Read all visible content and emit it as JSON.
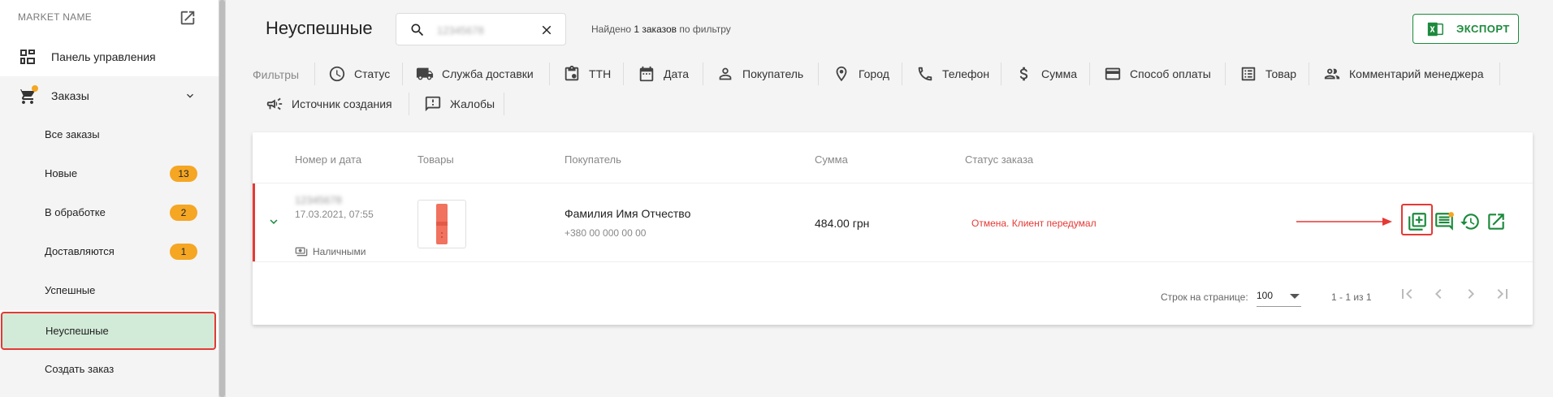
{
  "sidebar": {
    "market_name": "MARKET NAME",
    "dashboard_label": "Панель управления",
    "orders_label": "Заказы",
    "items": [
      {
        "label": "Все заказы",
        "badge": ""
      },
      {
        "label": "Новые",
        "badge": "13"
      },
      {
        "label": "В обработке",
        "badge": "2"
      },
      {
        "label": "Доставляются",
        "badge": "1"
      },
      {
        "label": "Успешные",
        "badge": ""
      },
      {
        "label": "Неуспешные",
        "badge": "",
        "active": true
      },
      {
        "label": "Создать заказ",
        "badge": ""
      }
    ],
    "badge_color": "#f5a623",
    "active_color": "#d2ebd8"
  },
  "header": {
    "title": "Неуспешные",
    "search_value": "12345678",
    "found_prefix": "Найдено ",
    "found_count": "1",
    "found_suffix": " заказов",
    "found_tail": " по фильтру",
    "export_label": "ЭКСПОРТ"
  },
  "filters": {
    "label": "Фильтры",
    "items": [
      {
        "label": "Статус",
        "icon": "clock-icon"
      },
      {
        "label": "Служба доставки",
        "icon": "truck-icon"
      },
      {
        "label": "ТТН",
        "icon": "clipboard-icon"
      },
      {
        "label": "Дата",
        "icon": "calendar-icon"
      },
      {
        "label": "Покупатель",
        "icon": "person-icon"
      },
      {
        "label": "Город",
        "icon": "location-icon"
      },
      {
        "label": "Телефон",
        "icon": "phone-icon"
      },
      {
        "label": "Сумма",
        "icon": "dollar-icon"
      },
      {
        "label": "Способ оплаты",
        "icon": "card-icon"
      },
      {
        "label": "Товар",
        "icon": "list-icon"
      },
      {
        "label": "Комментарий менеджера",
        "icon": "people-icon"
      },
      {
        "label": "Источник создания",
        "icon": "megaphone-icon"
      },
      {
        "label": "Жалобы",
        "icon": "feedback-icon"
      }
    ]
  },
  "table": {
    "columns": [
      "Номер и дата",
      "Товары",
      "Покупатель",
      "Сумма",
      "Статус заказа"
    ],
    "row": {
      "number": "12345678",
      "date": "17.03.2021, 07:55",
      "payment": "Наличными",
      "buyer": "Фамилия Имя Отчество",
      "phone": "+380 00 000 00 00",
      "sum": "484.00 грн",
      "status": "Отмена. Клиент передумал",
      "status_color": "#e53935",
      "actions": [
        "add-box-icon",
        "comment-icon",
        "history-icon",
        "open-external-icon"
      ]
    }
  },
  "pagination": {
    "rows_label": "Строк на странице:",
    "rows_value": "100",
    "range": "1 - 1 из 1"
  },
  "colors": {
    "accent": "#1b8a3c",
    "alert": "#e53935"
  }
}
